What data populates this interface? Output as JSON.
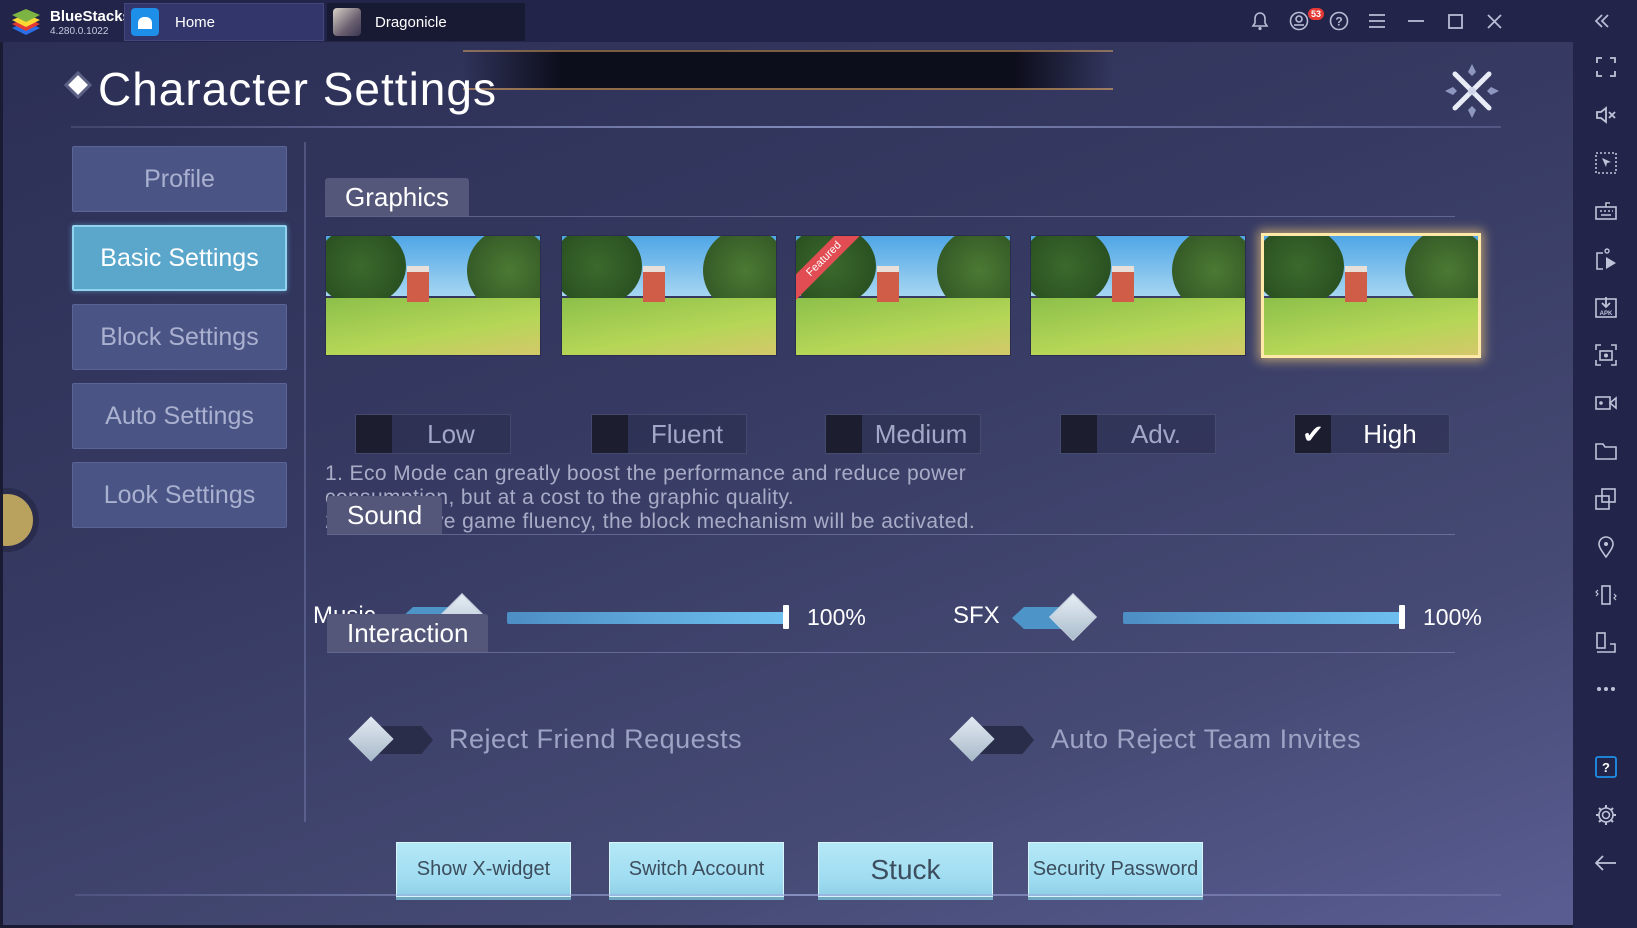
{
  "titlebar": {
    "app_name": "BlueStacks",
    "version": "4.280.0.1022",
    "tabs": [
      {
        "label": "Home",
        "icon": "home-icon"
      },
      {
        "label": "Dragonicle",
        "icon": "game-avatar-icon"
      }
    ],
    "notification_count": "53",
    "icons": [
      "bell-icon",
      "account-icon",
      "help-icon",
      "menu-icon",
      "minimize-icon",
      "maximize-icon",
      "close-icon",
      "collapse-sidebar-icon"
    ]
  },
  "right_sidebar": {
    "icons": [
      "fullscreen-icon",
      "mute-icon",
      "select-region-icon",
      "keyboard-icon",
      "macro-play-icon",
      "install-apk-icon",
      "screenshot-icon",
      "record-icon",
      "folder-icon",
      "multi-instance-icon",
      "location-icon",
      "shake-icon",
      "rotate-icon",
      "more-icon",
      "help-icon",
      "settings-icon",
      "back-icon"
    ]
  },
  "page": {
    "title": "Character Settings",
    "nav": [
      {
        "label": "Profile",
        "active": false
      },
      {
        "label": "Basic Settings",
        "active": true
      },
      {
        "label": "Block Settings",
        "active": false
      },
      {
        "label": "Auto Settings",
        "active": false
      },
      {
        "label": "Look Settings",
        "active": false
      }
    ]
  },
  "graphics": {
    "heading": "Graphics",
    "featured_label": "Featured",
    "options": [
      {
        "label": "Low",
        "checked": false
      },
      {
        "label": "Fluent",
        "checked": false
      },
      {
        "label": "Medium",
        "checked": false,
        "featured": true
      },
      {
        "label": "Adv.",
        "checked": false
      },
      {
        "label": "High",
        "checked": true
      }
    ],
    "selected": "High",
    "notes": [
      "1. Eco Mode can greatly boost the performance and reduce power",
      "consumption, but at a cost to the graphic quality.",
      "2. To improve game fluency, the block mechanism will be activated."
    ]
  },
  "sound": {
    "heading": "Sound",
    "music": {
      "label": "Music",
      "value_text": "100%",
      "value": 100
    },
    "sfx": {
      "label": "SFX",
      "value_text": "100%",
      "value": 100
    }
  },
  "interaction": {
    "heading": "Interaction",
    "toggles": [
      {
        "label": "Reject Friend Requests",
        "on": false
      },
      {
        "label": "Auto Reject Team Invites",
        "on": false
      }
    ]
  },
  "buttons": {
    "show_xwidget": "Show X-widget",
    "switch_account": "Switch Account",
    "stuck": "Stuck",
    "security_password": "Security Password"
  },
  "colors": {
    "accent_active_nav": "#5ba7cc",
    "slider_fill": "#6ec0f0",
    "notification_badge": "#e53935",
    "featured_ribbon": "#e24c53",
    "selected_glow": "#ffe9a8"
  }
}
